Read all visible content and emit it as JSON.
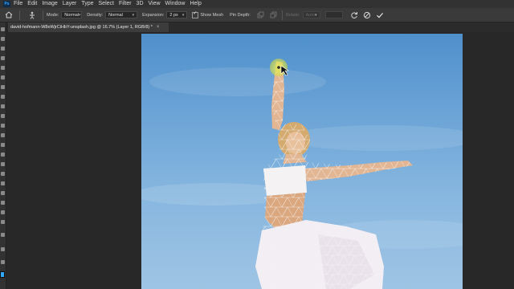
{
  "menu": [
    "File",
    "Edit",
    "Image",
    "Layer",
    "Type",
    "Select",
    "Filter",
    "3D",
    "View",
    "Window",
    "Help"
  ],
  "app_icon": "Ps",
  "options": {
    "mode_label": "Mode:",
    "mode_value": "Normal",
    "density_label": "Density:",
    "density_value": "Normal",
    "expansion_label": "Expansion:",
    "expansion_value": "2 px",
    "show_mesh_label": "Show Mesh",
    "show_mesh_checked": true,
    "pin_depth_label": "Pin Depth:",
    "rotate_label": "Rotate:",
    "rotate_value": "Auto"
  },
  "document": {
    "tab_title": "david-hofmann-W8eWjrCiHbY-unsplash.jpg @ 16.7% (Layer 1, RGB/8) *",
    "close_glyph": "×"
  },
  "colors": {
    "accent": "#31a8ff",
    "ui_bg": "#282828",
    "menubar": "#323232",
    "optbar": "#3a3a3a"
  }
}
